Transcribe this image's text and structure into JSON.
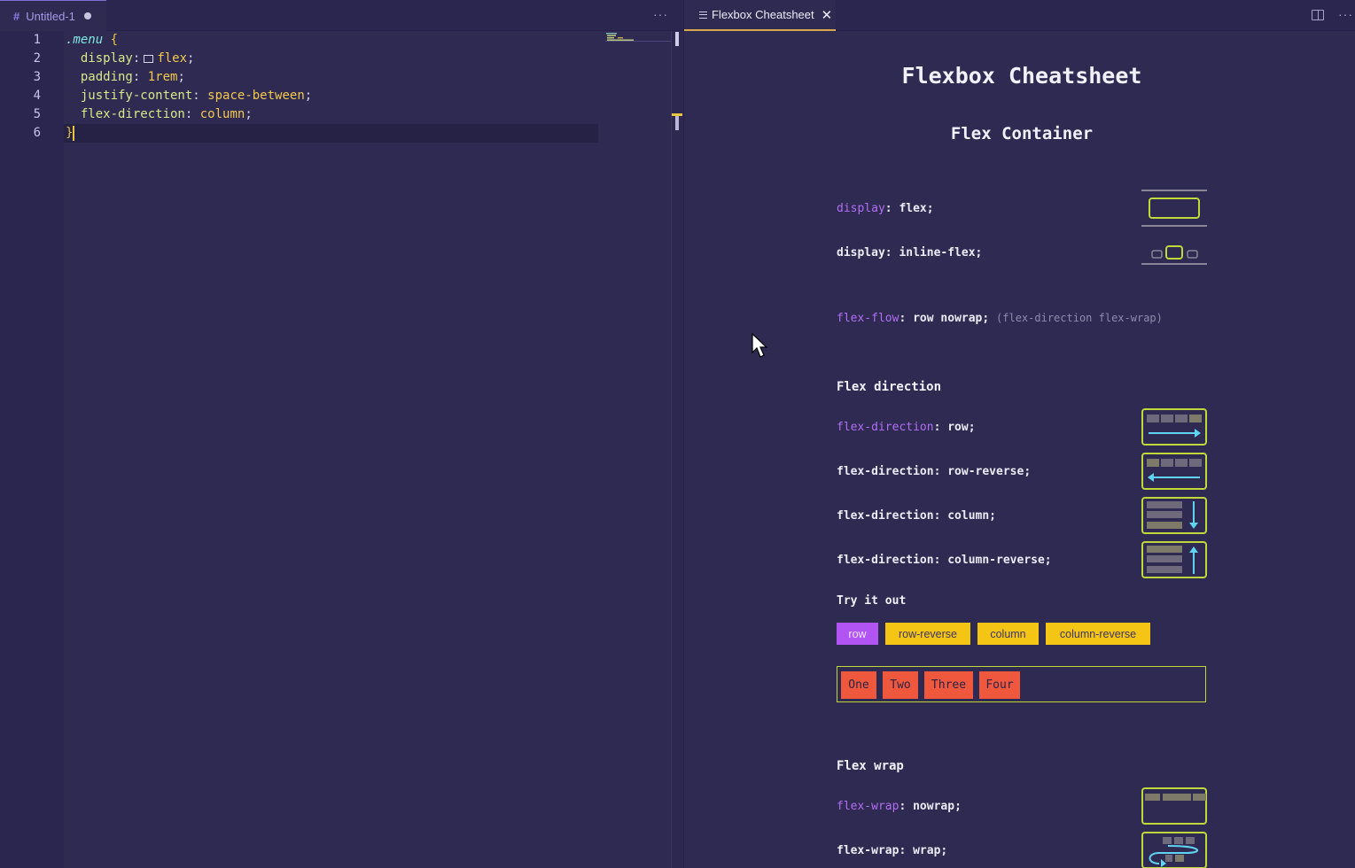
{
  "editor": {
    "tab": {
      "icon": "#",
      "title": "Untitled-1",
      "more": "···"
    },
    "line_numbers": [
      "1",
      "2",
      "3",
      "4",
      "5",
      "6"
    ],
    "code": {
      "l1": {
        "selector": ".menu",
        "brace": "{"
      },
      "l2": {
        "prop": "display",
        "colon": ":",
        "value": "flex",
        "semi": ";"
      },
      "l3": {
        "prop": "padding",
        "colon": ":",
        "value": "1rem",
        "semi": ";"
      },
      "l4": {
        "prop": "justify-content",
        "colon": ":",
        "value": "space-between",
        "semi": ";"
      },
      "l5": {
        "prop": "flex-direction",
        "colon": ":",
        "value": "column",
        "semi": ";"
      },
      "l6": {
        "brace": "}"
      }
    }
  },
  "preview": {
    "tab": {
      "title": "Flexbox Cheatsheet",
      "close": "✕",
      "more": "···"
    },
    "title": "Flexbox Cheatsheet",
    "section_container": "Flex Container",
    "display_flex": {
      "kw": "display",
      "rest": ": flex;"
    },
    "display_inline": "display: inline-flex;",
    "flex_flow": {
      "kw": "flex-flow",
      "rest": ": row nowrap;",
      "note": "(flex-direction flex-wrap)"
    },
    "section_direction": "Flex direction",
    "dir_row": {
      "kw": "flex-direction",
      "rest": ": row;"
    },
    "dir_row_reverse": "flex-direction: row-reverse;",
    "dir_column": "flex-direction: column;",
    "dir_column_reverse": "flex-direction: column-reverse;",
    "try_it": "Try it out",
    "buttons": [
      "row",
      "row-reverse",
      "column",
      "column-reverse"
    ],
    "items": [
      "One",
      "Two",
      "Three",
      "Four"
    ],
    "section_wrap": "Flex wrap",
    "wrap_nowrap": {
      "kw": "flex-wrap",
      "rest": ": nowrap;"
    },
    "wrap_wrap": "flex-wrap: wrap;"
  },
  "colors": {
    "background": "#2f2a52",
    "accent_green": "#c0d83a",
    "accent_purple": "#b154f3",
    "accent_yellow": "#f5c516",
    "item_red": "#f0583e",
    "arrow_cyan": "#5fd3f0"
  }
}
